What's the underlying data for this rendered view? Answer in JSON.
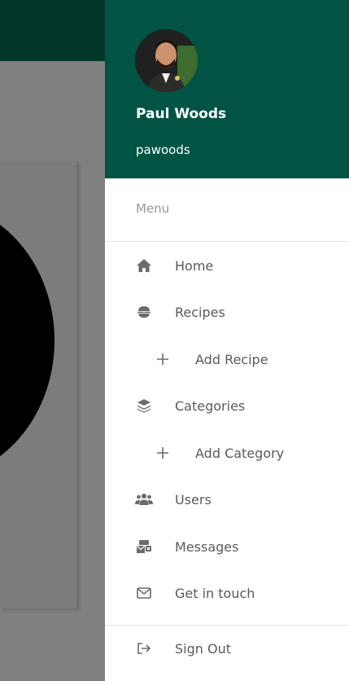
{
  "profile": {
    "name": "Paul Woods",
    "handle": "pawoods"
  },
  "menu": {
    "heading": "Menu",
    "items": [
      {
        "label": "Home",
        "icon": "home-icon"
      },
      {
        "label": "Recipes",
        "icon": "bowl-icon"
      },
      {
        "label": "Add Recipe",
        "icon": "plus-icon"
      },
      {
        "label": "Categories",
        "icon": "layers-icon"
      },
      {
        "label": "Add Category",
        "icon": "plus-icon"
      },
      {
        "label": "Users",
        "icon": "users-icon"
      },
      {
        "label": "Messages",
        "icon": "mail-box-icon"
      },
      {
        "label": "Get in touch",
        "icon": "envelope-icon"
      }
    ],
    "sign_out": {
      "label": "Sign Out",
      "icon": "sign-out-icon"
    }
  },
  "colors": {
    "header": "#015443",
    "topbar": "#013628",
    "overlay": "#808080",
    "icon": "#6b6b6b"
  }
}
